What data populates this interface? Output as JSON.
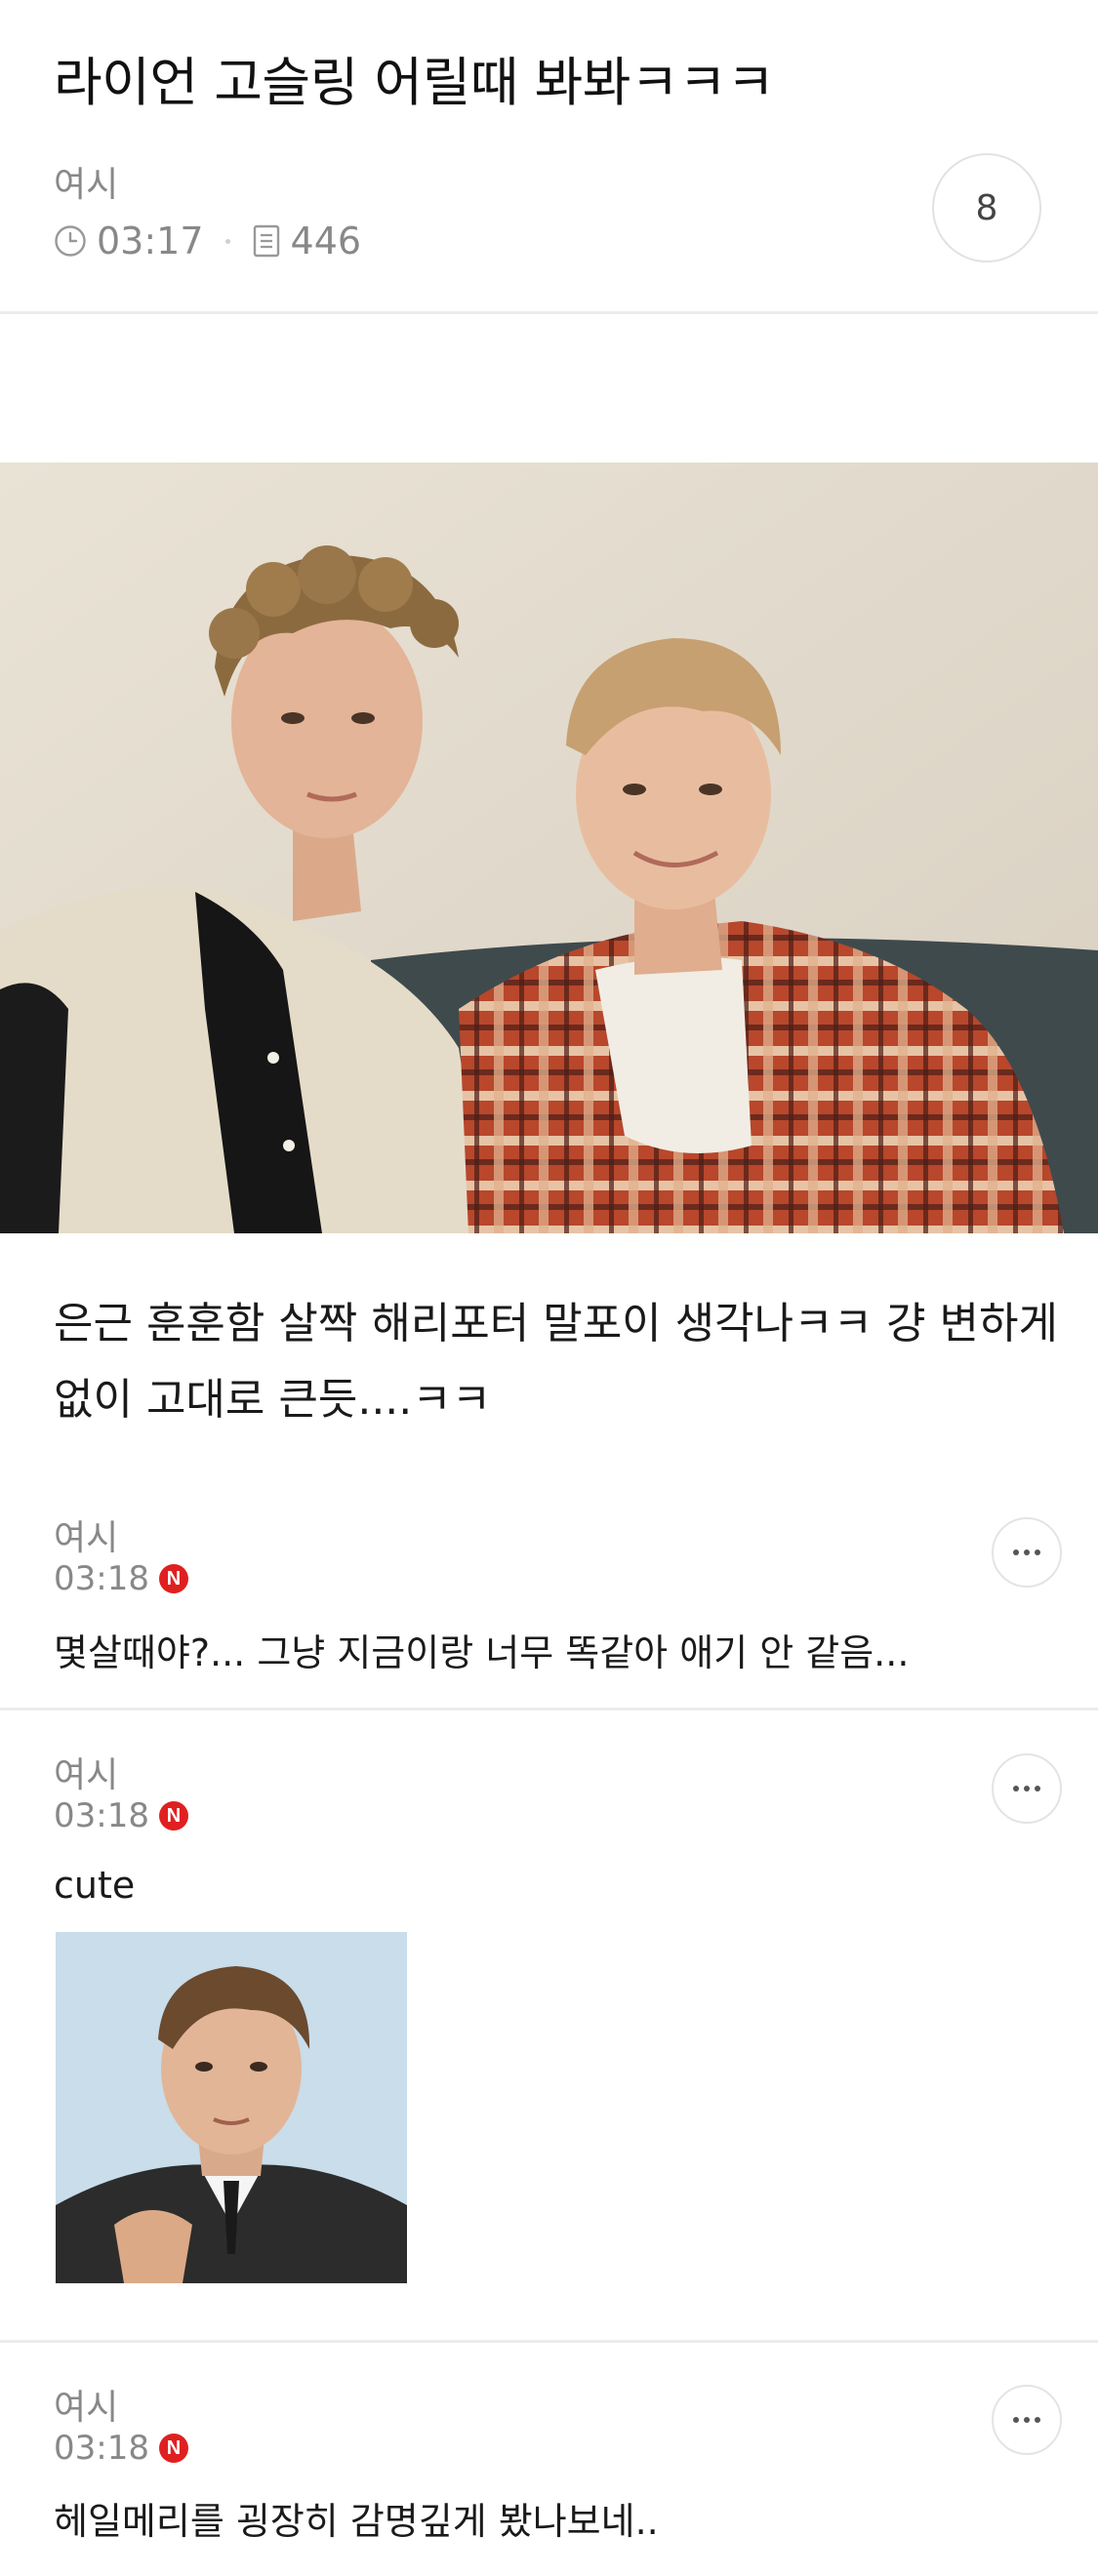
{
  "post": {
    "title": "라이언 고슬링 어릴때 봐봐ㅋㅋㅋ",
    "author": "여시",
    "time": "03:17",
    "views": "446",
    "comment_count": "8",
    "body": "은근 훈훈함 살짝 해리포터 말포이 생각나ㅋㅋ 걍 변하게 없이 고대로 큰듯....ㅋㅋ",
    "photo_icon": "childhood-photo"
  },
  "comments": [
    {
      "author": "여시",
      "time": "03:18",
      "badge": "N",
      "text": "몇살때야?... 그냥 지금이랑 너무 똑같아 애기 안 같음..."
    },
    {
      "author": "여시",
      "time": "03:18",
      "badge": "N",
      "text": "cute"
    },
    {
      "author": "여시",
      "time": "03:18",
      "badge": "N",
      "text": "헤일메리를 굉장히 감명깊게 봤나보네.."
    }
  ],
  "colors": {
    "badge": "#e02020",
    "meta": "#888888",
    "divider": "#ececec"
  }
}
